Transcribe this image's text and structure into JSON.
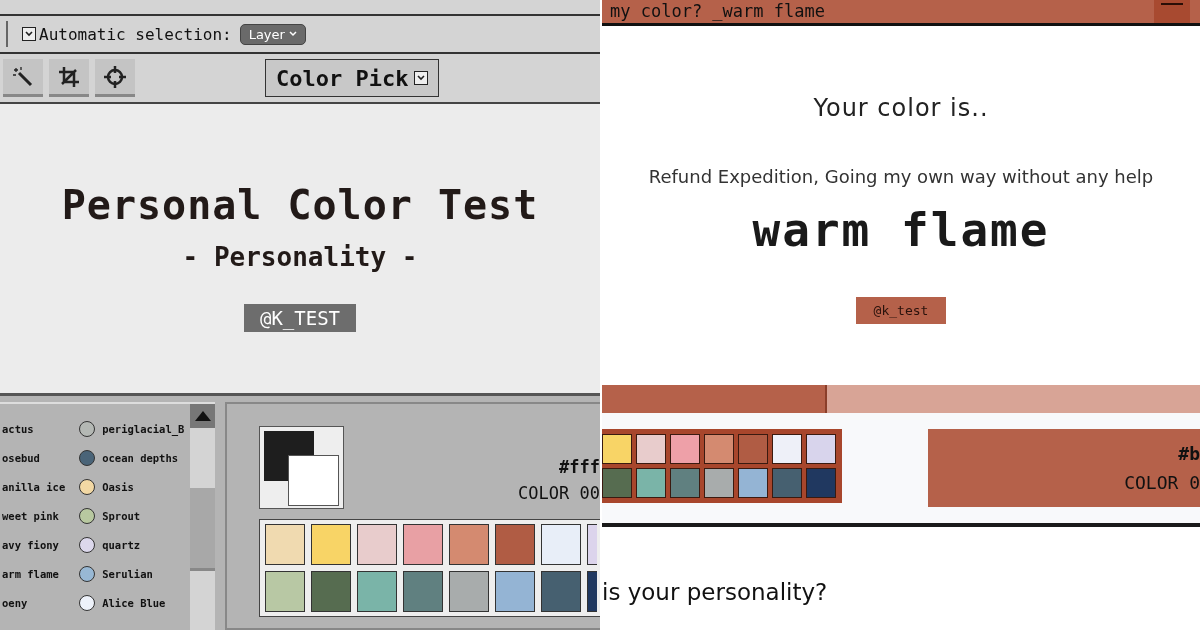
{
  "left_window": {
    "toolbar": {
      "auto_select": {
        "label": "Automatic selection:",
        "checked": true
      },
      "dropdown": "Layer"
    },
    "mode_button": {
      "label": "Color Pick",
      "checked": true
    },
    "title": "Personal Color Test",
    "subtitle": "- Personality -",
    "badge": "@K_TEST",
    "color_list": {
      "column_1": [
        "actus",
        "osebud",
        "anilla ice",
        "weet pink",
        "avy fiony",
        "arm flame",
        "oeny"
      ],
      "column_2": [
        {
          "name": "periglacial_B",
          "color": "#b4b8b4"
        },
        {
          "name": "ocean depths",
          "color": "#4a6478"
        },
        {
          "name": "Oasis",
          "color": "#f2d8a4"
        },
        {
          "name": "Sprout",
          "color": "#b8c8a0"
        },
        {
          "name": "quartz",
          "color": "#dcd8ec"
        },
        {
          "name": "Serulian",
          "color": "#98b8d4"
        },
        {
          "name": "Alice Blue",
          "color": "#eef2fa"
        }
      ]
    },
    "color_panel": {
      "hex": "#fff",
      "code": "COLOR 00",
      "palette": [
        [
          {
            "color": "#f0dab0"
          },
          {
            "color": "#f8d466"
          },
          {
            "color": "#e8cccc"
          },
          {
            "color": "#e8a0a4"
          },
          {
            "color": "#d48a70"
          },
          {
            "color": "#b05c44"
          },
          {
            "color": "#e8eef8"
          },
          {
            "color": "#dcd4ec"
          }
        ],
        [
          {
            "color": "#b8c8a4"
          },
          {
            "color": "#566c50"
          },
          {
            "color": "#7ab4a8"
          },
          {
            "color": "#608080"
          },
          {
            "color": "#a8acac"
          },
          {
            "color": "#94b4d4"
          },
          {
            "color": "#466070"
          },
          {
            "color": "#203860"
          }
        ]
      ]
    }
  },
  "right_window": {
    "title": "my color? _warm flame",
    "heading": "Your color is..",
    "description": "Refund Expedition, Going my own way without any help",
    "result": "warm flame",
    "badge": "@k_test",
    "progress": {
      "level": 0.376
    },
    "palette": [
      [
        {
          "color": "#f8d466"
        },
        {
          "color": "#e8cccc"
        },
        {
          "color": "#eea0a8"
        },
        {
          "color": "#d48a70"
        },
        {
          "color": "#b05c44"
        },
        {
          "color": "#eef0f8"
        },
        {
          "color": "#d8d4ec"
        }
      ],
      [
        {
          "color": "#566c50"
        },
        {
          "color": "#7ab4a8"
        },
        {
          "color": "#608080"
        },
        {
          "color": "#a8acac"
        },
        {
          "color": "#94b4d4"
        },
        {
          "color": "#466070"
        },
        {
          "color": "#203860"
        }
      ]
    ],
    "color_card": {
      "color": "#b5614a",
      "hex": "#b",
      "code": "COLOR 0"
    },
    "question": "is your personality?"
  }
}
